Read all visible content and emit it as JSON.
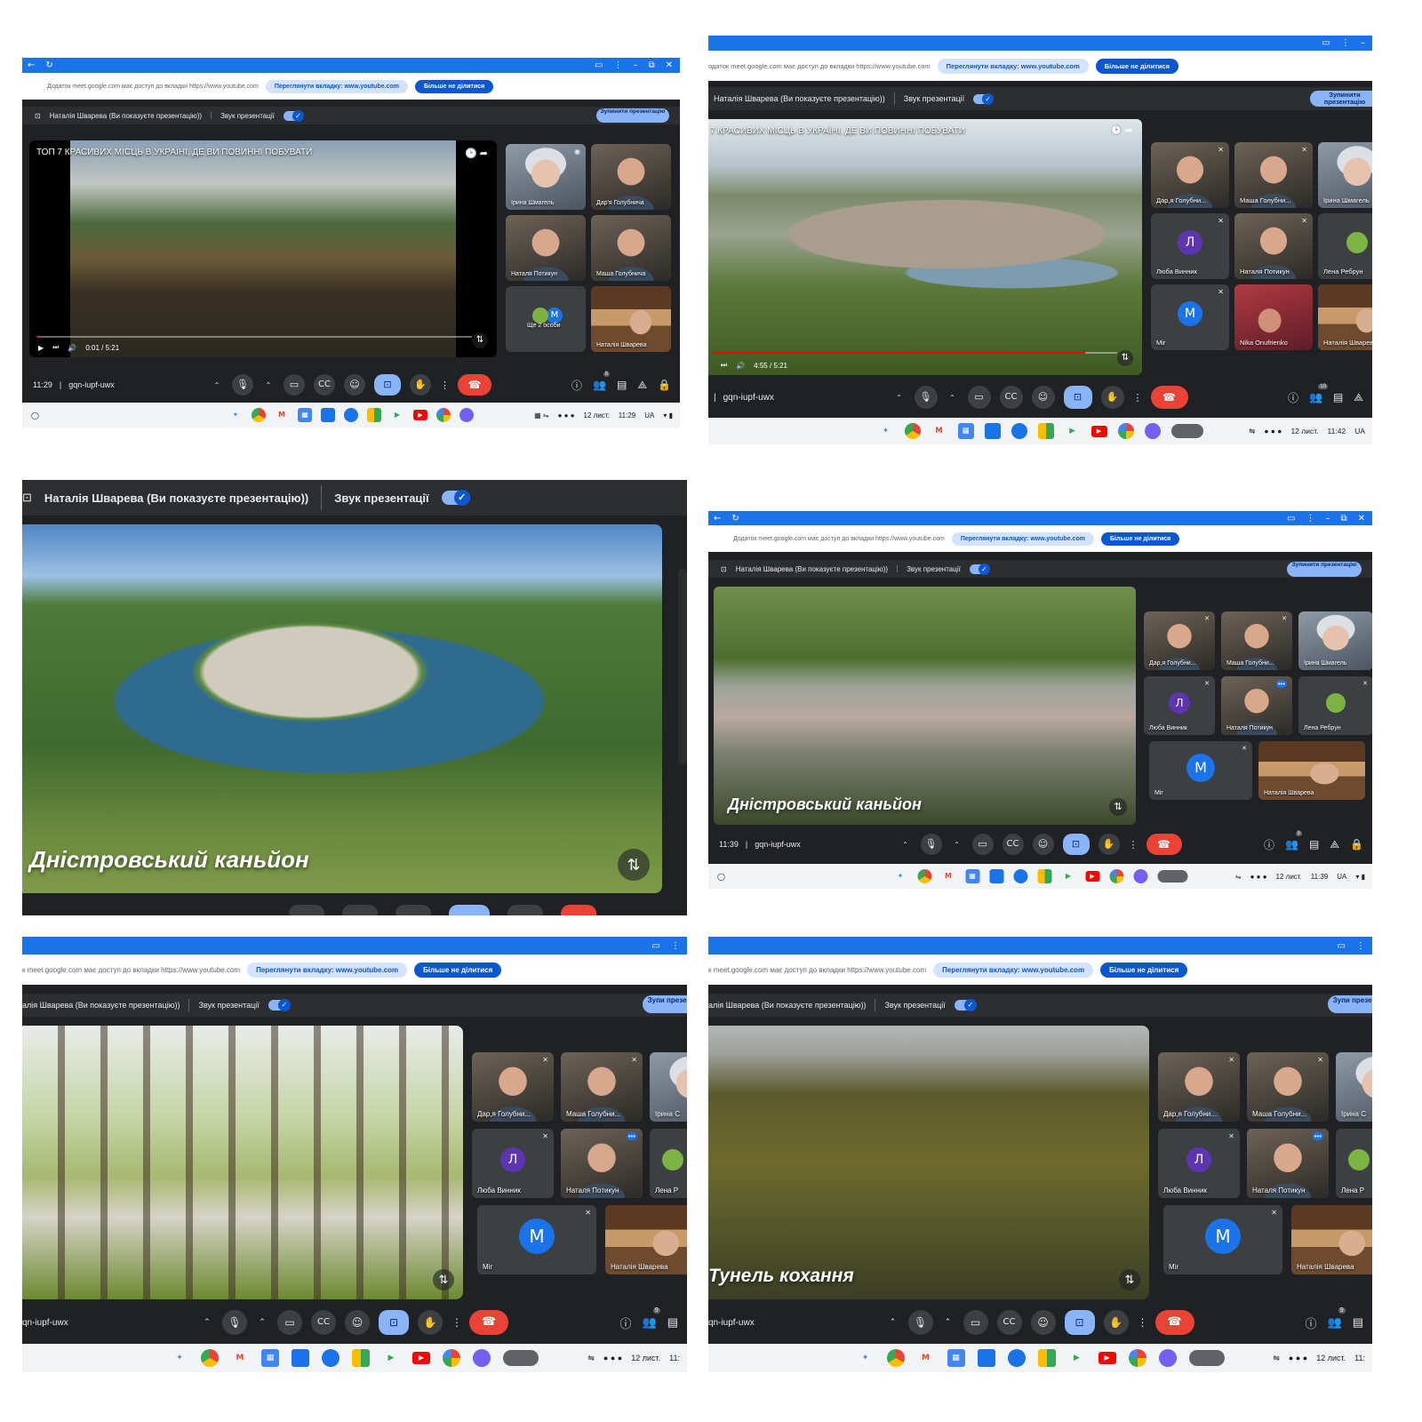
{
  "collage": {
    "panels": [
      {
        "id": "p1",
        "browser_chrome": true,
        "share_notice": "Додаток meet.google.com має доступ до вкладки https://www.youtube.com",
        "view_tab_button": "Переглянути вкладку: www.youtube.com",
        "stop_sharing_button": "Більше не ділитися",
        "presenter_label": "Наталія Шварева (Ви показуєте презентацію))",
        "presentation_audio_label": "Звук презентації",
        "stop_presenting_button": "Зупинити презентацію",
        "video_title": "ТОП 7 КРАСИВИХ МІСЦЬ В УКРАЇНІ, ДЕ ВИ ПОВИННІ ПОБУВАТИ",
        "video_time": "0:01 / 5:21",
        "progress": 0.005,
        "caption": "",
        "participants": [
          {
            "name": "Ірина Шмагель",
            "type": "photo",
            "style": "grey",
            "active": true
          },
          {
            "name": "Дар'я Голубнича",
            "type": "photo",
            "style": "default"
          },
          {
            "name": "Наталя Потикун",
            "type": "photo",
            "style": "default"
          },
          {
            "name": "Маша Голубнича",
            "type": "photo",
            "style": "default"
          },
          {
            "name": "Ще 2 особи",
            "type": "avatar",
            "letter": "M",
            "color": "#1a73e8"
          },
          {
            "name": "Наталія Шварева",
            "type": "photo",
            "style": "kitchen"
          }
        ],
        "clock": "11:29",
        "meeting_code": "gqn-iupf-uwx",
        "participant_count": "8",
        "shelf_date": "12 лист.",
        "shelf_time": "11:29",
        "shelf_locale": "UA"
      },
      {
        "id": "p2",
        "browser_chrome": false,
        "share_notice": "одаток meet.google.com має доступ до вкладки https://www.youtube.com",
        "view_tab_button": "Переглянути вкладку: www.youtube.com",
        "stop_sharing_button": "Більше не ділитися",
        "presenter_label": "Наталія Шварева (Ви показуєте презентацію))",
        "presentation_audio_label": "Звук презентації",
        "stop_presenting_button": "Зупинити презентацію",
        "video_title": "7 КРАСИВИХ МІСЦЬ В УКРАЇНІ, ДЕ ВИ ПОВИННІ ПОБУВАТИ",
        "video_time": "4:55 / 5:21",
        "progress": 0.92,
        "caption": "",
        "participants": [
          {
            "name": "Дар,я Голубни...",
            "type": "photo",
            "style": "default"
          },
          {
            "name": "Маша Голубни...",
            "type": "photo",
            "style": "default"
          },
          {
            "name": "Ірина Шмагель",
            "type": "photo",
            "style": "grey"
          },
          {
            "name": "Люба Винник",
            "type": "avatar",
            "letter": "Л",
            "color": "#5e35b1"
          },
          {
            "name": "Наталя Потикун",
            "type": "photo",
            "style": "default"
          },
          {
            "name": "Лена Ребрун",
            "type": "photo",
            "style": "default"
          },
          {
            "name": "Mir",
            "type": "avatar",
            "letter": "M",
            "color": "#1a73e8"
          },
          {
            "name": "Nika Onufrienko",
            "type": "photo",
            "style": "red"
          },
          {
            "name": "Наталія Шварева",
            "type": "photo",
            "style": "kitchen",
            "active": true
          }
        ],
        "clock": "",
        "meeting_code": "gqn-iupf-uwx",
        "participant_count": "10",
        "shelf_date": "12 лист.",
        "shelf_time": "11:42",
        "shelf_locale": "UA"
      },
      {
        "id": "p3",
        "presenter_label": "Наталія Шварева (Ви показуєте презентацію))",
        "presentation_audio_label": "Звук презентації",
        "caption": "Дністровський каньйон"
      },
      {
        "id": "p4",
        "browser_chrome": true,
        "share_notice": "Додаток meet.google.com має доступ до вкладки https://www.youtube.com",
        "view_tab_button": "Переглянути вкладку: www.youtube.com",
        "stop_sharing_button": "Більше не ділитися",
        "presenter_label": "Наталія Шварева (Ви показуєте презентацію))",
        "presentation_audio_label": "Звук презентації",
        "stop_presenting_button": "Зупинити презентацію",
        "video_title": "",
        "video_time": "",
        "progress": 0,
        "caption": "Дністровський каньйон",
        "participants": [
          {
            "name": "Дар,я Голубни...",
            "type": "photo",
            "style": "default"
          },
          {
            "name": "Маша Голубни...",
            "type": "photo",
            "style": "default"
          },
          {
            "name": "Ірина Шмагель",
            "type": "photo",
            "style": "grey"
          },
          {
            "name": "Люба Винник",
            "type": "avatar",
            "letter": "Л",
            "color": "#5e35b1"
          },
          {
            "name": "Наталя Потикун",
            "type": "photo",
            "style": "default",
            "active": true
          },
          {
            "name": "Лена Ребрун",
            "type": "photo",
            "style": "default"
          },
          {
            "name": "Mir",
            "type": "avatar",
            "letter": "M",
            "color": "#1a73e8"
          },
          {
            "name": "Наталія Шварева",
            "type": "photo",
            "style": "kitchen"
          }
        ],
        "clock": "11:39",
        "meeting_code": "gqn-iupf-uwx",
        "participant_count": "9",
        "shelf_date": "12 лист.",
        "shelf_time": "11:39",
        "shelf_locale": "UA"
      },
      {
        "id": "p5",
        "browser_chrome": false,
        "share_notice": "к meet.google.com має доступ до вкладки https://www.youtube.com",
        "view_tab_button": "Переглянути вкладку: www.youtube.com",
        "stop_sharing_button": "Більше не ділитися",
        "presenter_label": "алія Шварева (Ви показуєте презентацію))",
        "presentation_audio_label": "Звук презентації",
        "stop_presenting_button": "Зупи презен",
        "video_title": "",
        "video_time": "",
        "progress": 0,
        "caption": "",
        "participants": [
          {
            "name": "Дар,я Голубни...",
            "type": "photo",
            "style": "default"
          },
          {
            "name": "Маша Голубни...",
            "type": "photo",
            "style": "default"
          },
          {
            "name": "Ірина С",
            "type": "photo",
            "style": "grey"
          },
          {
            "name": "Люба Винник",
            "type": "avatar",
            "letter": "Л",
            "color": "#5e35b1"
          },
          {
            "name": "Наталя Потикун",
            "type": "photo",
            "style": "default",
            "active": true
          },
          {
            "name": "Лена Р",
            "type": "photo",
            "style": "default"
          },
          {
            "name": "Mir",
            "type": "avatar",
            "letter": "M",
            "color": "#1a73e8"
          },
          {
            "name": "Наталія Шварева",
            "type": "photo",
            "style": "kitchen"
          }
        ],
        "clock": "",
        "meeting_code": "qn-iupf-uwx",
        "participant_count": "9",
        "shelf_date": "12 лист.",
        "shelf_time": "11:",
        "shelf_locale": ""
      },
      {
        "id": "p6",
        "browser_chrome": false,
        "share_notice": "к meet.google.com має доступ до вкладки https://www.youtube.com",
        "view_tab_button": "Переглянути вкладку: www.youtube.com",
        "stop_sharing_button": "Більше не ділитися",
        "presenter_label": "алія Шварева (Ви показуєте презентацію))",
        "presentation_audio_label": "Звук презентації",
        "stop_presenting_button": "Зупи презен",
        "video_title": "",
        "video_time": "",
        "progress": 0,
        "caption": "Тунель кохання",
        "participants": [
          {
            "name": "Дар,я Голубни...",
            "type": "photo",
            "style": "default"
          },
          {
            "name": "Маша Голубни...",
            "type": "photo",
            "style": "default"
          },
          {
            "name": "Ірина С",
            "type": "photo",
            "style": "grey"
          },
          {
            "name": "Люба Винник",
            "type": "avatar",
            "letter": "Л",
            "color": "#5e35b1"
          },
          {
            "name": "Наталя Потикун",
            "type": "photo",
            "style": "default",
            "active": true
          },
          {
            "name": "Лена Р",
            "type": "photo",
            "style": "default"
          },
          {
            "name": "Mir",
            "type": "avatar",
            "letter": "M",
            "color": "#1a73e8"
          },
          {
            "name": "Наталія Шварева",
            "type": "photo",
            "style": "kitchen"
          }
        ],
        "clock": "",
        "meeting_code": "qn-iupf-uwx",
        "participant_count": "9",
        "shelf_date": "12 лист.",
        "shelf_time": "11:",
        "shelf_locale": ""
      }
    ]
  },
  "icons": {
    "back": "back-arrow-icon",
    "reload": "reload-icon",
    "mic": "microphone-icon",
    "camera": "camera-icon",
    "captions": "captions-icon",
    "emoji": "emoji-icon",
    "present": "present-screen-icon",
    "hand": "raise-hand-icon",
    "more": "more-vert-icon",
    "end": "end-call-icon",
    "info": "info-icon",
    "people": "people-icon",
    "chat": "chat-icon",
    "activities": "activities-icon",
    "lock": "host-controls-icon"
  },
  "colors": {
    "chrome_blue": "#1a73e8",
    "meet_dark": "#202124",
    "end_call_red": "#ea4335",
    "accent_light": "#8ab4f8"
  }
}
